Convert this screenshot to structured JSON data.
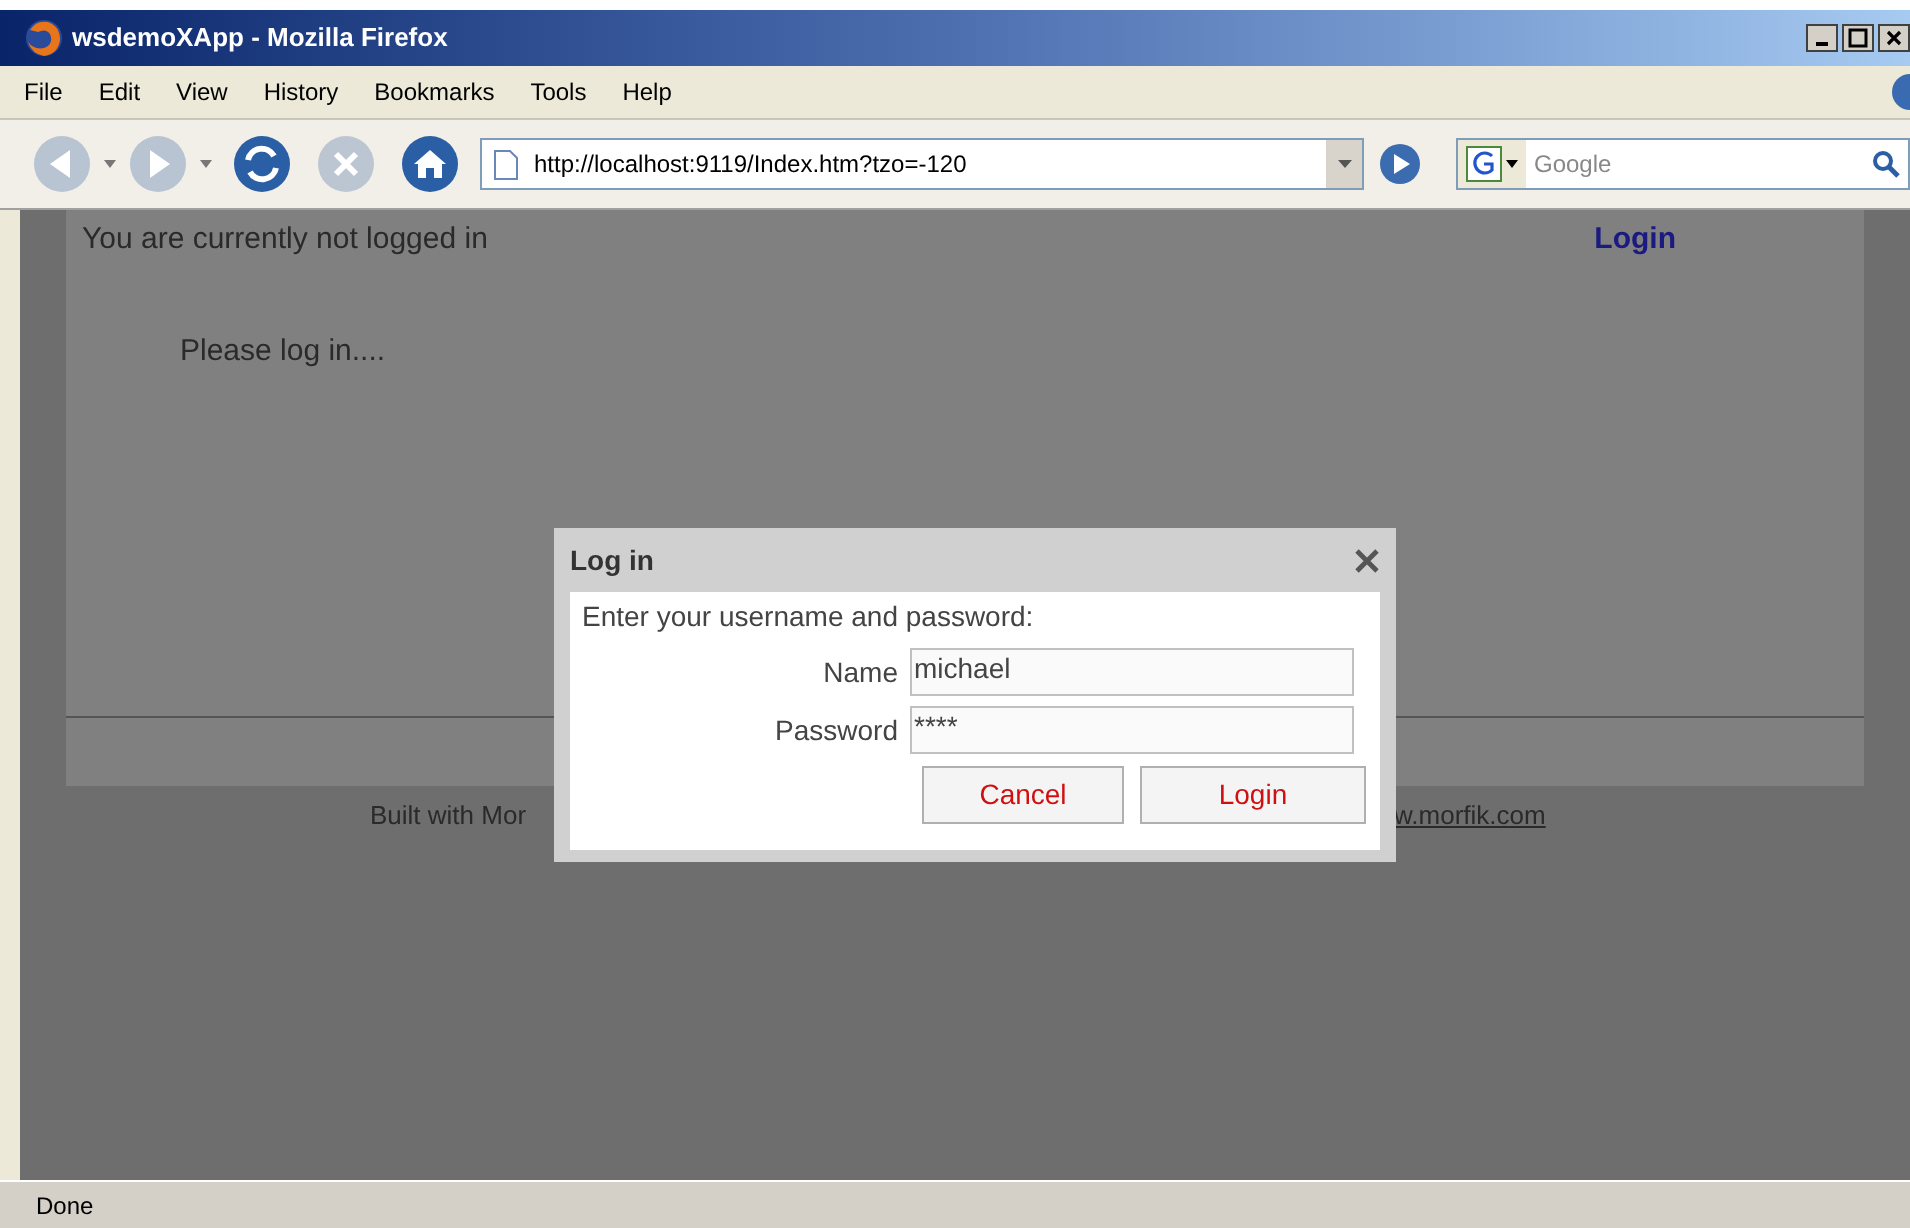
{
  "window": {
    "title": "wsdemoXApp - Mozilla Firefox"
  },
  "menu": [
    "File",
    "Edit",
    "View",
    "History",
    "Bookmarks",
    "Tools",
    "Help"
  ],
  "toolbar": {
    "url": "http://localhost:9119/Index.htm?tzo=-120",
    "search_placeholder": "Google"
  },
  "page": {
    "status_text": "You are currently not logged in",
    "login_link": "Login",
    "message": "Please log in....",
    "footer_left": "Built with Mor",
    "footer_link": "w.morfik.com"
  },
  "dialog": {
    "title": "Log in",
    "prompt": "Enter your username and password:",
    "fields": [
      {
        "label": "Name",
        "value": "michael"
      },
      {
        "label": "Password",
        "value": "****"
      }
    ],
    "buttons": [
      "Cancel",
      "Login"
    ]
  },
  "status_bar": "Done"
}
